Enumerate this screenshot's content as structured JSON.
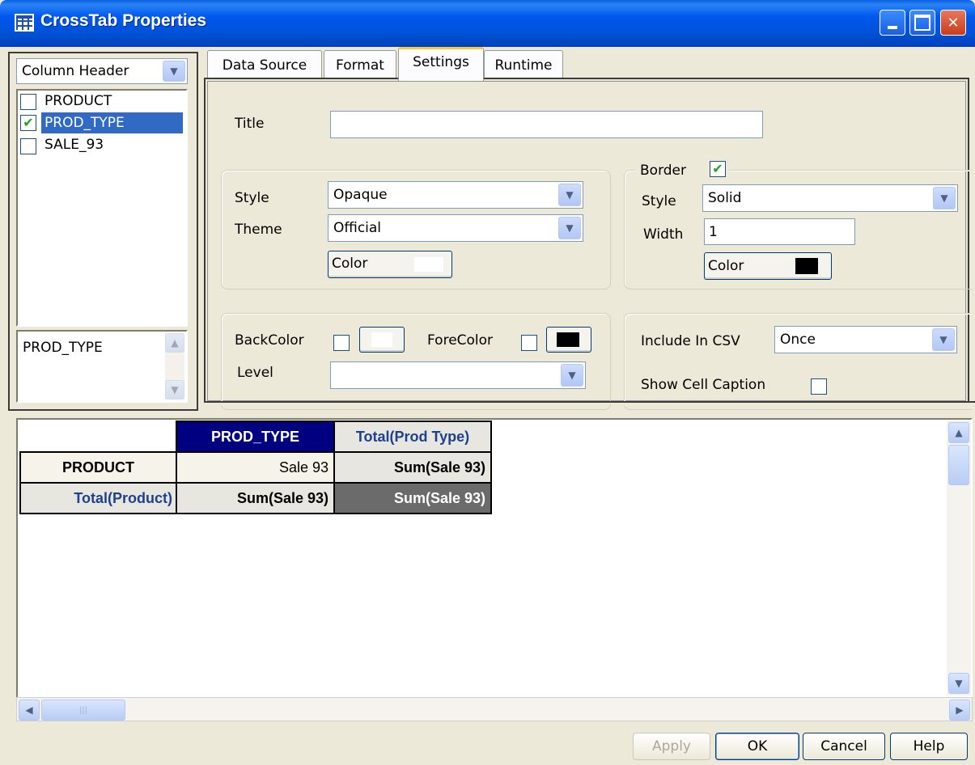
{
  "window": {
    "title": "CrossTab Properties"
  },
  "left_panel": {
    "dropdown_value": "Column Header",
    "fields": [
      {
        "label": "PRODUCT",
        "checked": false,
        "selected": false
      },
      {
        "label": "PROD_TYPE",
        "checked": true,
        "selected": true
      },
      {
        "label": "SALE_93",
        "checked": false,
        "selected": false
      }
    ],
    "selected_text": "PROD_TYPE"
  },
  "tabs": [
    "Data Source",
    "Format",
    "Settings",
    "Runtime"
  ],
  "active_tab": "Settings",
  "settings": {
    "title_label": "Title",
    "title_value": "",
    "style_label": "Style",
    "style_value": "Opaque",
    "theme_label": "Theme",
    "theme_value": "Official",
    "color_label": "Color",
    "border_label": "Border",
    "border_checked": true,
    "border_style_label": "Style",
    "border_style_value": "Solid",
    "border_width_label": "Width",
    "border_width_value": "1",
    "border_color_label": "Color",
    "backcolor_label": "BackColor",
    "forecolor_label": "ForeColor",
    "level_label": "Level",
    "level_value": "",
    "include_csv_label": "Include In CSV",
    "include_csv_value": "Once",
    "show_caption_label": "Show Cell Caption"
  },
  "crosstab": {
    "col_header": "PROD_TYPE",
    "col_total": "Total(Prod Type)",
    "row_header": "PRODUCT",
    "row_total": "Total(Product)",
    "cell_value": "Sale 93",
    "sum_right": "Sum(Sale 93)",
    "sum_bottom": "Sum(Sale 93)",
    "sum_grand": "Sum(Sale 93)"
  },
  "buttons": {
    "apply": "Apply",
    "ok": "OK",
    "cancel": "Cancel",
    "help": "Help"
  },
  "colors": {
    "header_navy": "#000080",
    "total_blue": "#1f3f8f",
    "grand_total_bg": "#6b6b6b"
  }
}
